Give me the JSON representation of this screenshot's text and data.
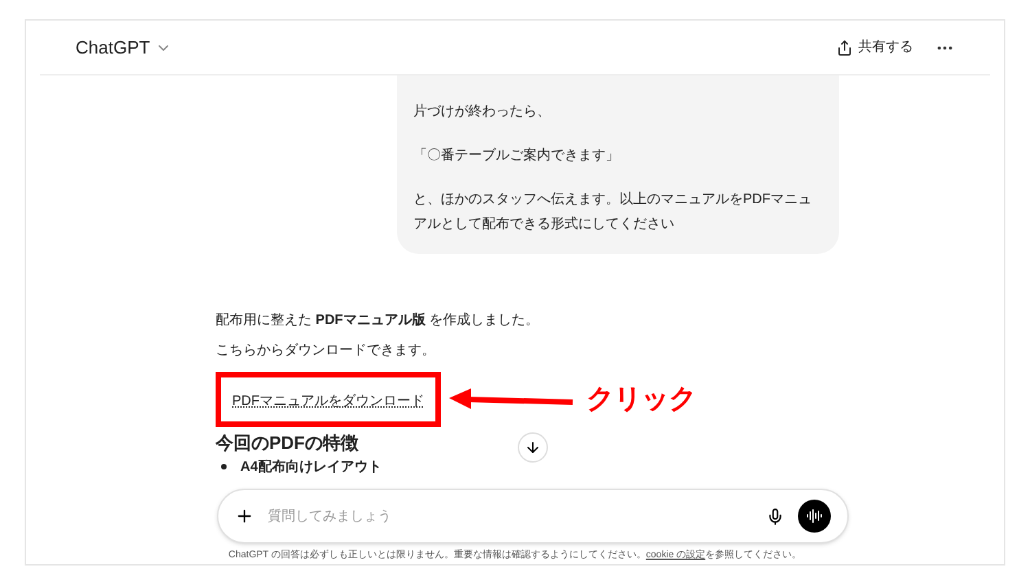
{
  "header": {
    "title": "ChatGPT",
    "share": "共有する"
  },
  "user_message": [
    "片づけが終わったら、",
    "「〇番テーブルご案内できます」",
    "と、ほかのスタッフへ伝えます。以上のマニュアルをPDFマニュアルとして配布できる形式にしてください"
  ],
  "assistant": {
    "lines": [
      "配布用に整えた **PDFマニュアル版** を作成しました。",
      "こちらからダウンロードできます。"
    ],
    "download_link": "PDFマニュアルをダウンロード",
    "annotation": "クリック",
    "heading": "今回のPDFの特徴",
    "bullets": [
      "A4配布向けレイアウト"
    ]
  },
  "composer": {
    "placeholder": "質問してみましょう"
  },
  "footer": {
    "before": "ChatGPT の回答は必ずしも正しいとは限りません。重要な情報は確認するようにしてください。",
    "link": "cookie の設定",
    "after": "を参照してください。"
  }
}
